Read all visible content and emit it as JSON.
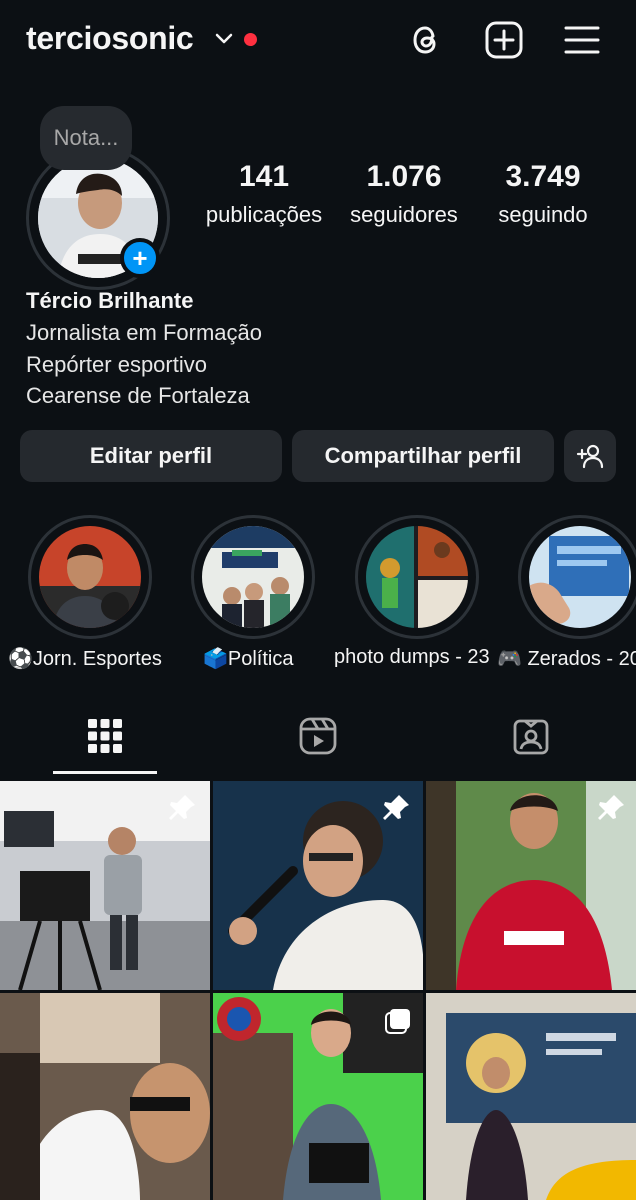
{
  "header": {
    "username": "terciosonic",
    "icons": [
      "chevron-down-icon",
      "threads-icon",
      "create-post-icon",
      "menu-icon"
    ],
    "notification_dot_color": "#ff3040"
  },
  "profile": {
    "note_placeholder": "Nota...",
    "add_story_symbol": "+",
    "stats": [
      {
        "value": "141",
        "label": "publicações"
      },
      {
        "value": "1.076",
        "label": "seguidores"
      },
      {
        "value": "3.749",
        "label": "seguindo"
      }
    ],
    "full_name": "Tércio Brilhante",
    "bio_lines": [
      "Jornalista em Formação",
      "Repórter esportivo",
      "Cearense de Fortaleza"
    ]
  },
  "actions": {
    "edit_profile": "Editar perfil",
    "share_profile": "Compartilhar perfil"
  },
  "highlights": [
    {
      "label": "⚽Jorn. Esportes"
    },
    {
      "label": "🗳️Política"
    },
    {
      "label": "photo dumps - 23"
    },
    {
      "label": "🎮 Zerados - 20"
    }
  ],
  "tabs": [
    {
      "name": "grid-icon",
      "active": true
    },
    {
      "name": "reels-icon",
      "active": false
    },
    {
      "name": "tagged-icon",
      "active": false
    }
  ],
  "colors": {
    "background": "#0c1014",
    "button": "#25292e",
    "accent_blue": "#0095f6"
  }
}
